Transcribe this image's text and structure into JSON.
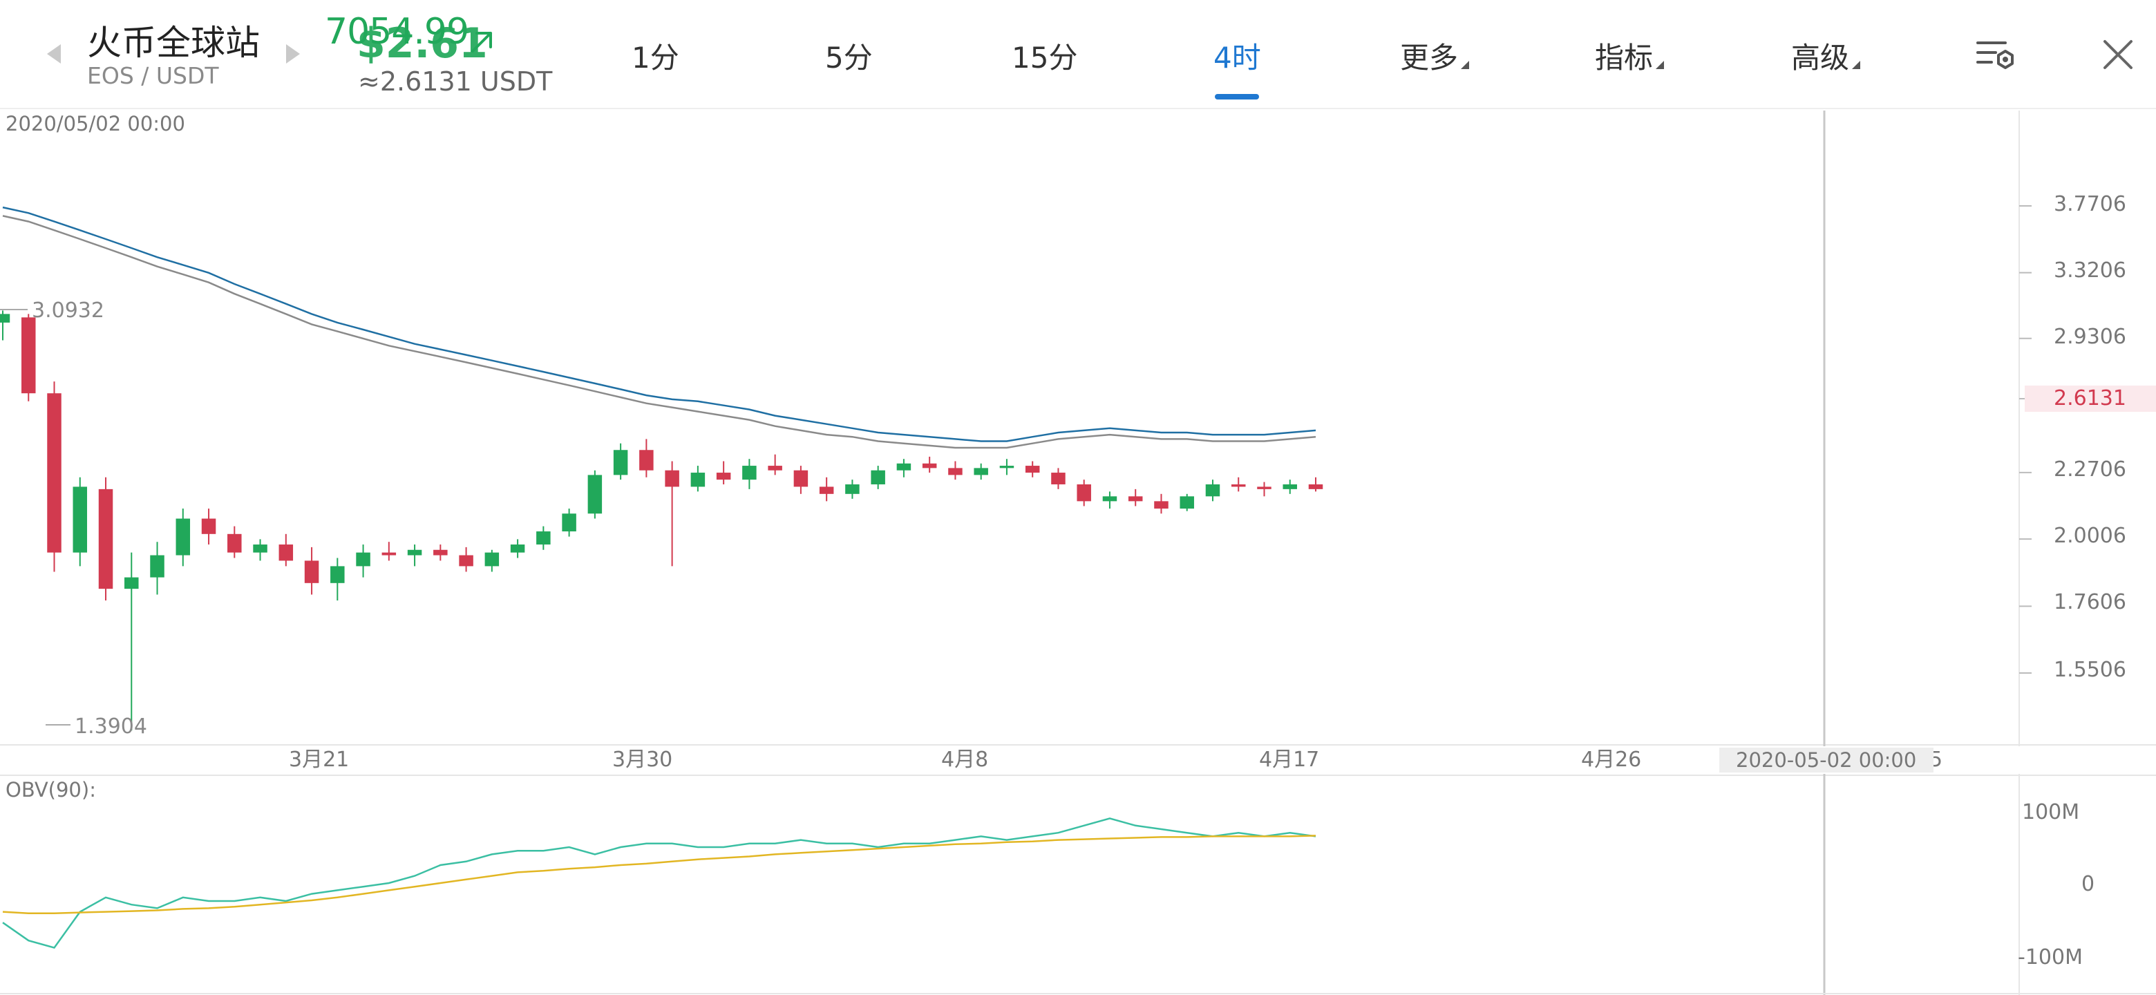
{
  "header": {
    "exchange_name": "火币全球站",
    "pair": "EOS / USDT",
    "last_price": "7054.99",
    "usd_price": "$2.61",
    "usdt_price": "≈2.6131 USDT",
    "price_color": "#21a85a",
    "trend_icon": "arrow-up-right-icon",
    "prev_icon": "chevron-left-icon",
    "next_icon": "chevron-right-icon",
    "settings_icon": "chart-settings-icon",
    "close_icon": "close-icon"
  },
  "tabs": [
    {
      "label": "1分",
      "active": false,
      "dropdown": false
    },
    {
      "label": "5分",
      "active": false,
      "dropdown": false
    },
    {
      "label": "15分",
      "active": false,
      "dropdown": false
    },
    {
      "label": "4时",
      "active": true,
      "dropdown": false
    },
    {
      "label": "更多",
      "active": false,
      "dropdown": true
    },
    {
      "label": "指标",
      "active": false,
      "dropdown": true
    },
    {
      "label": "高级",
      "active": false,
      "dropdown": true
    }
  ],
  "accent_color": "#1f78d1",
  "chart": {
    "timestamp": "2020/05/02 00:00",
    "crosshair_date": "2020-05-02 00:00",
    "current_price": "2.6131",
    "current_price_color": "#d23a4f",
    "max_label": "3.0932",
    "min_label": "1.3904",
    "obv_label": "OBV(90):"
  },
  "chart_data": [
    {
      "type": "candlestick",
      "scale": "log",
      "yticks": [
        "3.7706",
        "3.3206",
        "2.9306",
        "2.6131",
        "2.2706",
        "2.0006",
        "1.7606",
        "1.5506"
      ],
      "xticks": [
        "3月21",
        "3月30",
        "4月8",
        "4月17",
        "4月26",
        "5"
      ],
      "up_color": "#21a85a",
      "down_color": "#d23a4f",
      "series": [
        {
          "color": "#1f6fa3",
          "close": [
            3.76,
            3.72,
            3.66,
            3.6,
            3.54,
            3.48,
            3.42,
            3.37,
            3.32,
            3.25,
            3.19,
            3.13,
            3.07,
            3.02,
            2.98,
            2.94,
            2.9,
            2.87,
            2.84,
            2.81,
            2.78,
            2.75,
            2.72,
            2.69,
            2.66,
            2.63,
            2.61,
            2.6,
            2.58,
            2.56,
            2.53,
            2.51,
            2.49,
            2.47,
            2.45,
            2.44,
            2.43,
            2.42,
            2.41,
            2.41,
            2.43,
            2.45,
            2.46,
            2.47,
            2.46,
            2.45,
            2.45,
            2.44,
            2.44,
            2.44,
            2.45,
            2.46
          ]
        },
        {
          "color": "#8a8a8a",
          "close": [
            3.7,
            3.66,
            3.6,
            3.54,
            3.48,
            3.42,
            3.36,
            3.31,
            3.26,
            3.19,
            3.13,
            3.07,
            3.01,
            2.97,
            2.93,
            2.89,
            2.86,
            2.83,
            2.8,
            2.77,
            2.74,
            2.71,
            2.68,
            2.65,
            2.62,
            2.59,
            2.57,
            2.55,
            2.53,
            2.51,
            2.48,
            2.46,
            2.44,
            2.43,
            2.41,
            2.4,
            2.39,
            2.38,
            2.38,
            2.38,
            2.4,
            2.42,
            2.43,
            2.44,
            2.43,
            2.42,
            2.42,
            2.41,
            2.41,
            2.41,
            2.42,
            2.43
          ]
        }
      ],
      "candles": [
        [
          3.02,
          3.09,
          2.92,
          3.07
        ],
        [
          3.05,
          3.07,
          2.6,
          2.64
        ],
        [
          2.64,
          2.7,
          1.88,
          1.95
        ],
        [
          1.95,
          2.25,
          1.9,
          2.21
        ],
        [
          2.2,
          2.25,
          1.78,
          1.82
        ],
        [
          1.82,
          1.95,
          1.39,
          1.86
        ],
        [
          1.86,
          1.99,
          1.8,
          1.94
        ],
        [
          1.94,
          2.12,
          1.9,
          2.08
        ],
        [
          2.08,
          2.12,
          1.98,
          2.02
        ],
        [
          2.02,
          2.05,
          1.93,
          1.95
        ],
        [
          1.95,
          2.0,
          1.92,
          1.98
        ],
        [
          1.98,
          2.02,
          1.9,
          1.92
        ],
        [
          1.92,
          1.97,
          1.8,
          1.84
        ],
        [
          1.84,
          1.93,
          1.78,
          1.9
        ],
        [
          1.9,
          1.98,
          1.86,
          1.95
        ],
        [
          1.95,
          1.99,
          1.92,
          1.94
        ],
        [
          1.94,
          1.98,
          1.9,
          1.96
        ],
        [
          1.96,
          1.98,
          1.92,
          1.94
        ],
        [
          1.94,
          1.97,
          1.88,
          1.9
        ],
        [
          1.9,
          1.96,
          1.88,
          1.95
        ],
        [
          1.95,
          2.0,
          1.93,
          1.98
        ],
        [
          1.98,
          2.05,
          1.96,
          2.03
        ],
        [
          2.03,
          2.12,
          2.01,
          2.1
        ],
        [
          2.1,
          2.28,
          2.08,
          2.26
        ],
        [
          2.26,
          2.4,
          2.24,
          2.37
        ],
        [
          2.37,
          2.42,
          2.25,
          2.28
        ],
        [
          2.28,
          2.32,
          1.9,
          2.21
        ],
        [
          2.21,
          2.3,
          2.19,
          2.27
        ],
        [
          2.27,
          2.32,
          2.22,
          2.24
        ],
        [
          2.24,
          2.33,
          2.2,
          2.3
        ],
        [
          2.3,
          2.35,
          2.26,
          2.28
        ],
        [
          2.28,
          2.3,
          2.18,
          2.21
        ],
        [
          2.21,
          2.25,
          2.15,
          2.18
        ],
        [
          2.18,
          2.24,
          2.16,
          2.22
        ],
        [
          2.22,
          2.3,
          2.2,
          2.28
        ],
        [
          2.28,
          2.33,
          2.25,
          2.31
        ],
        [
          2.31,
          2.34,
          2.27,
          2.29
        ],
        [
          2.29,
          2.32,
          2.24,
          2.26
        ],
        [
          2.26,
          2.31,
          2.24,
          2.29
        ],
        [
          2.29,
          2.33,
          2.26,
          2.3
        ],
        [
          2.3,
          2.32,
          2.25,
          2.27
        ],
        [
          2.27,
          2.29,
          2.2,
          2.22
        ],
        [
          2.22,
          2.24,
          2.13,
          2.15
        ],
        [
          2.15,
          2.19,
          2.12,
          2.17
        ],
        [
          2.17,
          2.2,
          2.13,
          2.15
        ],
        [
          2.15,
          2.18,
          2.1,
          2.12
        ],
        [
          2.12,
          2.18,
          2.11,
          2.17
        ],
        [
          2.17,
          2.24,
          2.15,
          2.22
        ],
        [
          2.22,
          2.25,
          2.19,
          2.21
        ],
        [
          2.21,
          2.23,
          2.17,
          2.2
        ],
        [
          2.2,
          2.24,
          2.18,
          2.22
        ],
        [
          2.22,
          2.25,
          2.19,
          2.2
        ]
      ]
    },
    {
      "type": "line",
      "title": "OBV(90):",
      "yticks": [
        "100M",
        "0",
        "-100M"
      ],
      "series": [
        {
          "color": "#3bbfa3",
          "values": [
            -55,
            -80,
            -90,
            -40,
            -20,
            -30,
            -35,
            -20,
            -25,
            -25,
            -20,
            -25,
            -15,
            -10,
            -5,
            0,
            10,
            25,
            30,
            40,
            45,
            45,
            50,
            40,
            50,
            55,
            55,
            50,
            50,
            55,
            55,
            60,
            55,
            55,
            50,
            55,
            55,
            60,
            65,
            60,
            65,
            70,
            80,
            90,
            80,
            75,
            70,
            65,
            70,
            65,
            70,
            65
          ]
        },
        {
          "color": "#e2b623",
          "values": [
            -40,
            -42,
            -42,
            -41,
            -40,
            -39,
            -38,
            -36,
            -35,
            -33,
            -30,
            -27,
            -24,
            -20,
            -15,
            -10,
            -5,
            0,
            5,
            10,
            15,
            17,
            20,
            22,
            25,
            27,
            30,
            33,
            35,
            37,
            40,
            42,
            44,
            46,
            48,
            50,
            52,
            54,
            55,
            57,
            58,
            60,
            61,
            62,
            63,
            64,
            64,
            65,
            65,
            65,
            65,
            66
          ]
        }
      ]
    }
  ]
}
